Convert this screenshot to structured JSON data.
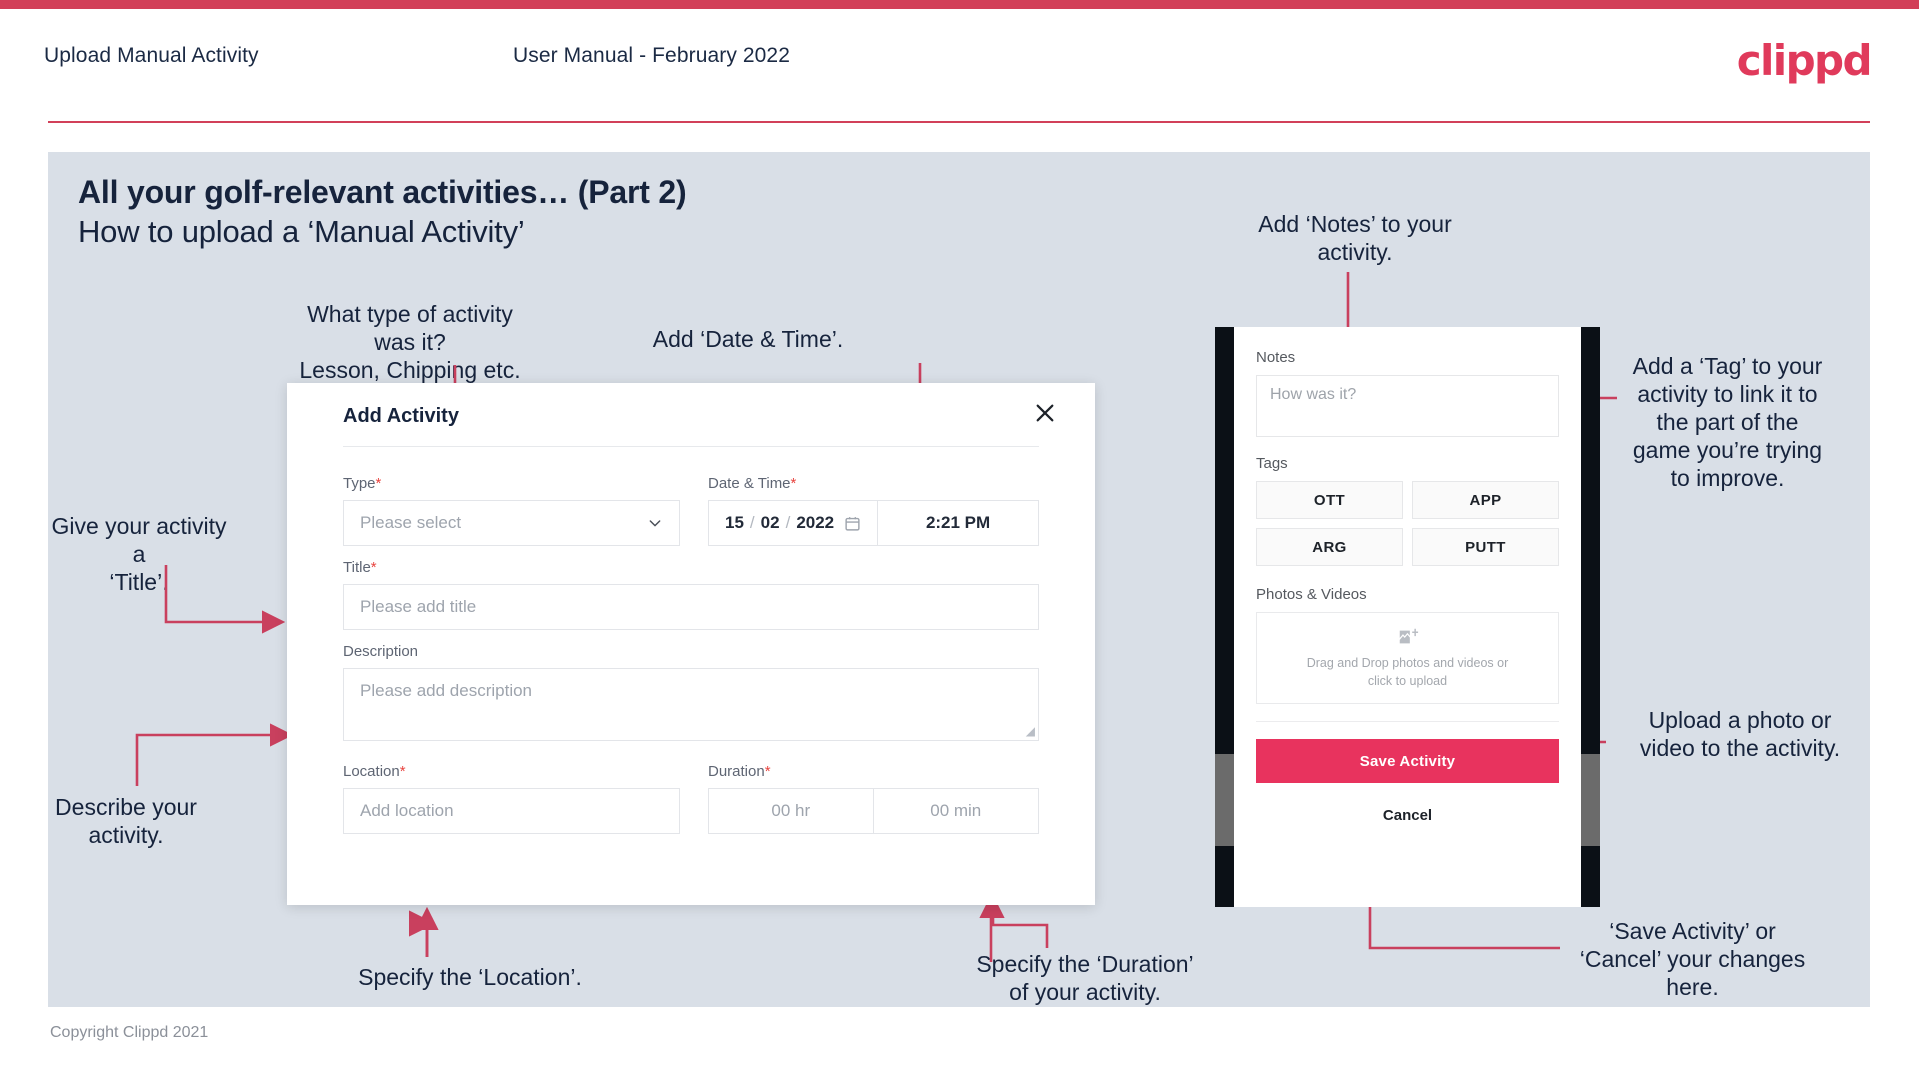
{
  "header": {
    "title": "Upload Manual Activity",
    "subtitle": "User Manual - February 2022",
    "logo": "clippd"
  },
  "slide": {
    "title": "All your golf-relevant activities… (Part 2)",
    "subtitle": "How to upload a ‘Manual Activity’",
    "copyright": "Copyright Clippd 2021"
  },
  "annotations": {
    "type": "What type of activity was it?\nLesson, Chipping etc.",
    "datetime": "Add ‘Date & Time’.",
    "title_field": "Give your activity a\n‘Title’.",
    "description": "Describe your\nactivity.",
    "location": "Specify the ‘Location’.",
    "duration": "Specify the ‘Duration’\nof your activity.",
    "notes": "Add ‘Notes’ to your\nactivity.",
    "tags": "Add a ‘Tag’ to your\nactivity to link it to\nthe part of the\ngame you’re trying\nto improve.",
    "upload": "Upload a photo or\nvideo to the activity.",
    "save_cancel": "‘Save Activity’ or\n‘Cancel’ your changes\nhere."
  },
  "modal": {
    "title": "Add Activity",
    "close_icon": "close-icon",
    "fields": {
      "type": {
        "label": "Type",
        "required": "*",
        "placeholder": "Please select",
        "icon": "chevron-down-icon"
      },
      "datetime": {
        "label": "Date & Time",
        "required": "*",
        "day": "15",
        "month": "02",
        "year": "2022",
        "sep": "/",
        "time": "2:21 PM",
        "icon": "calendar-icon"
      },
      "title": {
        "label": "Title",
        "required": "*",
        "placeholder": "Please add title"
      },
      "description": {
        "label": "Description",
        "required": "",
        "placeholder": "Please add description"
      },
      "location": {
        "label": "Location",
        "required": "*",
        "placeholder": "Add location"
      },
      "duration": {
        "label": "Duration",
        "required": "*",
        "hours_placeholder": "00 hr",
        "minutes_placeholder": "00 min"
      }
    }
  },
  "phone": {
    "notes": {
      "label": "Notes",
      "placeholder": "How was it?"
    },
    "tags": {
      "label": "Tags",
      "items": [
        "OTT",
        "APP",
        "ARG",
        "PUTT"
      ]
    },
    "photos": {
      "label": "Photos & Videos",
      "icon": "add-image-icon",
      "drop_text": "Drag and Drop photos and videos or\nclick to upload"
    },
    "save_label": "Save Activity",
    "cancel_label": "Cancel"
  },
  "colors": {
    "brand_pink": "#e8335e",
    "header_rule": "#d24059",
    "slide_bg": "#d9dfe7",
    "text_dark": "#16233c",
    "annotation_line": "#c9405e"
  }
}
